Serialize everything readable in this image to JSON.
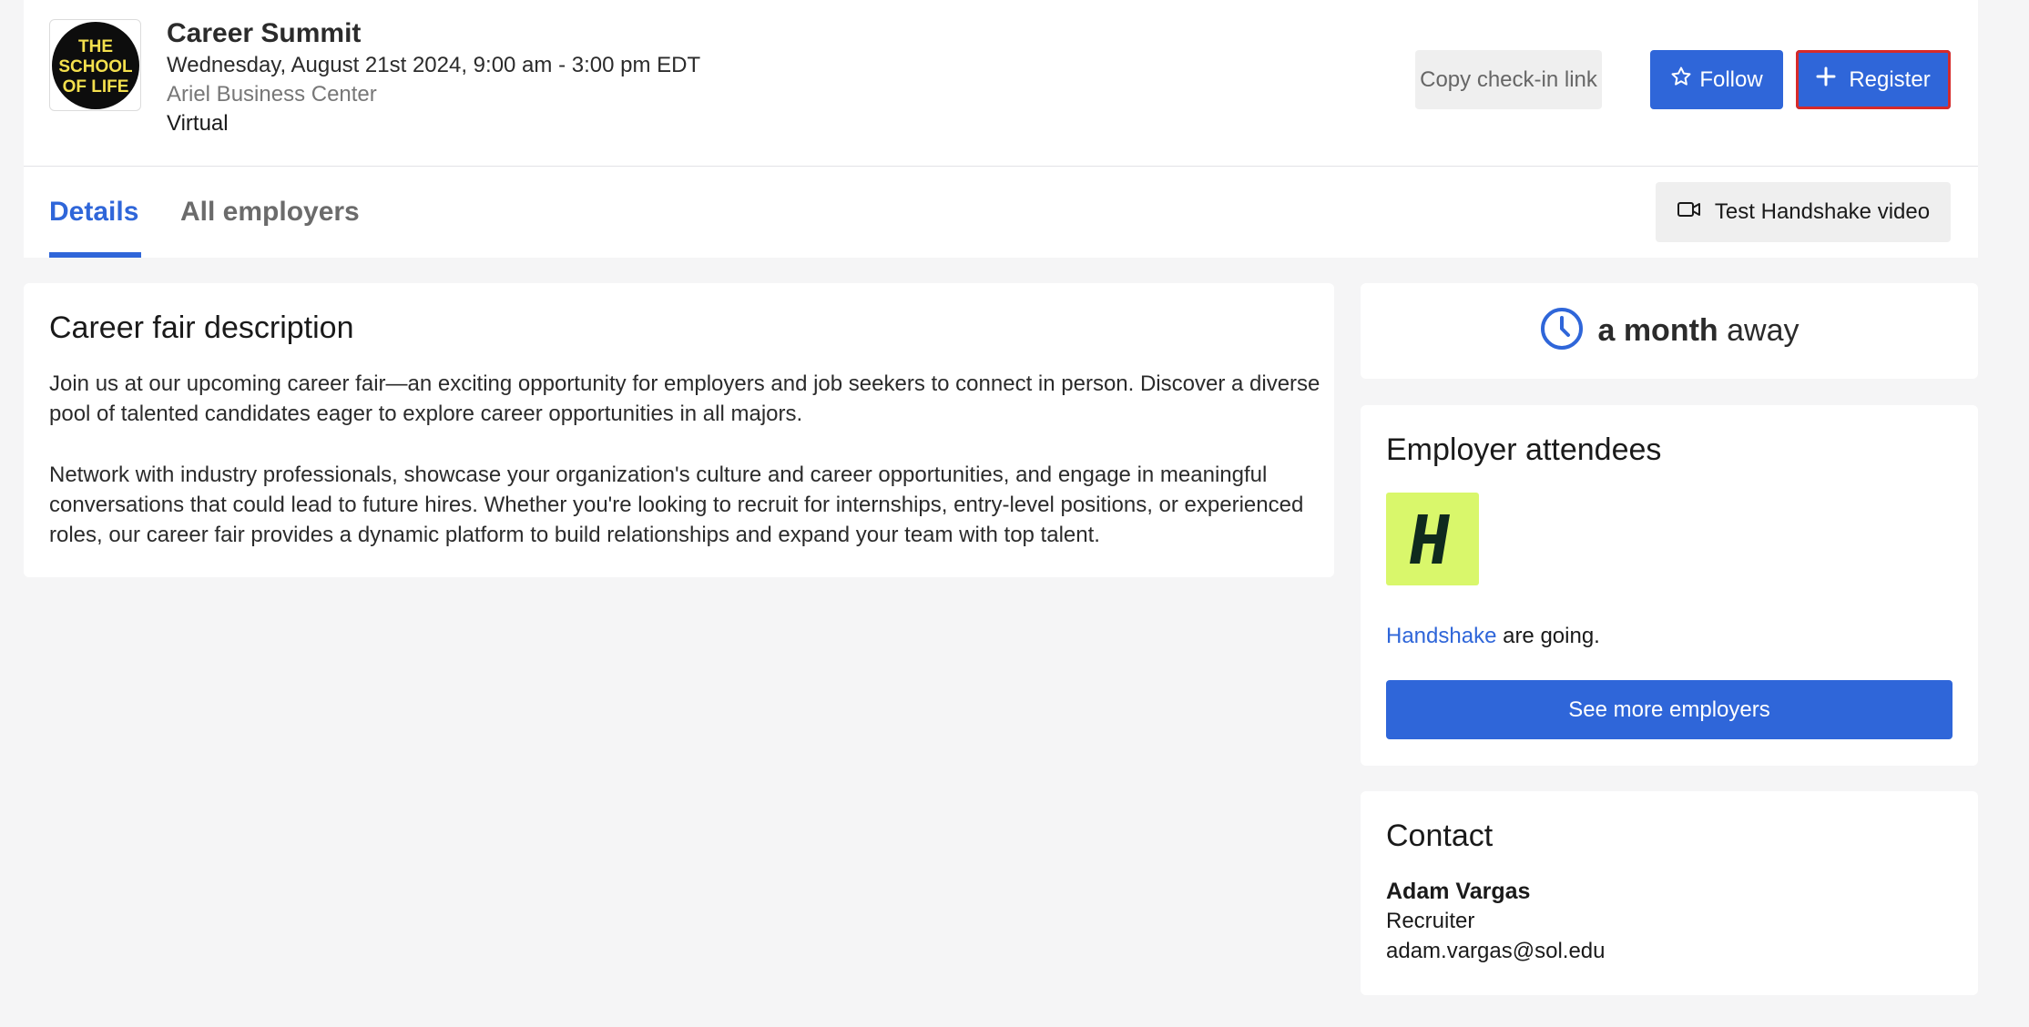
{
  "event": {
    "title": "Career Summit",
    "date": "Wednesday, August 21st 2024, 9:00 am - 3:00 pm EDT",
    "location": "Ariel Business Center",
    "mode": "Virtual",
    "logo_text": [
      "THE",
      "SCHOOL",
      "OF LIFE"
    ]
  },
  "actions": {
    "copy_label": "Copy check-in link",
    "follow_label": "Follow",
    "register_label": "Register"
  },
  "tabs": [
    {
      "label": "Details",
      "active": true
    },
    {
      "label": "All employers",
      "active": false
    }
  ],
  "video_button_label": "Test Handshake video",
  "description": {
    "title": "Career fair description",
    "paragraph1": "Join us at our upcoming career fair—an exciting opportunity for employers and job seekers to connect in person. Discover a diverse pool of talented candidates eager to explore career opportunities in all majors.",
    "paragraph2": "Network with industry professionals, showcase your organization's culture and career opportunities, and engage in meaningful conversations that could lead to future hires. Whether you're looking to recruit for internships, entry-level positions, or experienced roles, our career fair provides a dynamic platform to build relationships and expand your team with top talent."
  },
  "countdown": {
    "bold": "a month",
    "rest": "away",
    "icon": "clock-icon"
  },
  "employers": {
    "title": "Employer attendees",
    "employer_name": "Handshake",
    "going_suffix": " are going.",
    "see_more_label": "See more employers"
  },
  "contact": {
    "title": "Contact",
    "name": "Adam Vargas",
    "role": "Recruiter",
    "email": "adam.vargas@sol.edu"
  },
  "colors": {
    "accent": "#2f66d9",
    "highlight": "#d62a2a",
    "logo_yellow": "#f4e04d",
    "handshake_green": "#d9f76b"
  }
}
